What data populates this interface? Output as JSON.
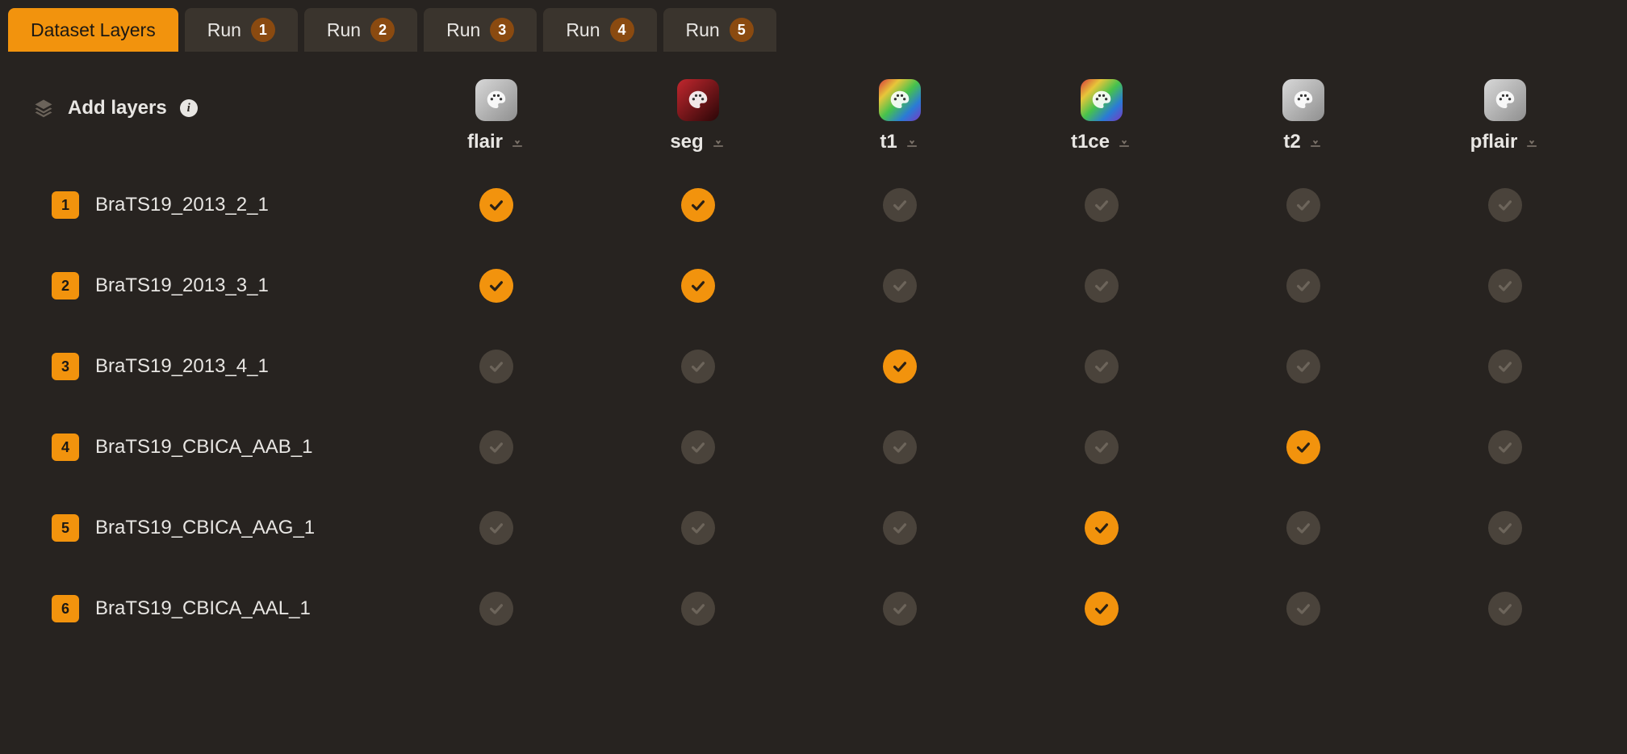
{
  "tabs": [
    {
      "label": "Dataset Layers",
      "active": true
    },
    {
      "label": "Run",
      "badge": "1",
      "active": false
    },
    {
      "label": "Run",
      "badge": "2",
      "active": false
    },
    {
      "label": "Run",
      "badge": "3",
      "active": false
    },
    {
      "label": "Run",
      "badge": "4",
      "active": false
    },
    {
      "label": "Run",
      "badge": "5",
      "active": false
    }
  ],
  "addLayers": {
    "label": "Add layers"
  },
  "columns": [
    {
      "key": "flair",
      "label": "flair",
      "palette": "gray"
    },
    {
      "key": "seg",
      "label": "seg",
      "palette": "red"
    },
    {
      "key": "t1",
      "label": "t1",
      "palette": "rainbow"
    },
    {
      "key": "t1ce",
      "label": "t1ce",
      "palette": "rainbow"
    },
    {
      "key": "t2",
      "label": "t2",
      "palette": "gray"
    },
    {
      "key": "pflair",
      "label": "pflair",
      "palette": "gray"
    }
  ],
  "rows": [
    {
      "num": "1",
      "name": "BraTS19_2013_2_1",
      "checks": {
        "flair": true,
        "seg": true,
        "t1": false,
        "t1ce": false,
        "t2": false,
        "pflair": false
      }
    },
    {
      "num": "2",
      "name": "BraTS19_2013_3_1",
      "checks": {
        "flair": true,
        "seg": true,
        "t1": false,
        "t1ce": false,
        "t2": false,
        "pflair": false
      }
    },
    {
      "num": "3",
      "name": "BraTS19_2013_4_1",
      "checks": {
        "flair": false,
        "seg": false,
        "t1": true,
        "t1ce": false,
        "t2": false,
        "pflair": false
      }
    },
    {
      "num": "4",
      "name": "BraTS19_CBICA_AAB_1",
      "checks": {
        "flair": false,
        "seg": false,
        "t1": false,
        "t1ce": false,
        "t2": true,
        "pflair": false
      }
    },
    {
      "num": "5",
      "name": "BraTS19_CBICA_AAG_1",
      "checks": {
        "flair": false,
        "seg": false,
        "t1": false,
        "t1ce": true,
        "t2": false,
        "pflair": false
      }
    },
    {
      "num": "6",
      "name": "BraTS19_CBICA_AAL_1",
      "checks": {
        "flair": false,
        "seg": false,
        "t1": false,
        "t1ce": true,
        "t2": false,
        "pflair": false
      }
    }
  ],
  "palettes": {
    "gray": "linear-gradient(135deg,#d8d8d8,#8f8f8f)",
    "red": "linear-gradient(135deg,#c2272e,#2a0607)",
    "rainbow": "linear-gradient(135deg,#d63a3c 0%,#e7c63a 25%,#46c24d 50%,#2a7bd6 75%,#7a3ac2 100%)"
  },
  "colors": {
    "accent": "#f2930d",
    "bg": "#272320"
  }
}
